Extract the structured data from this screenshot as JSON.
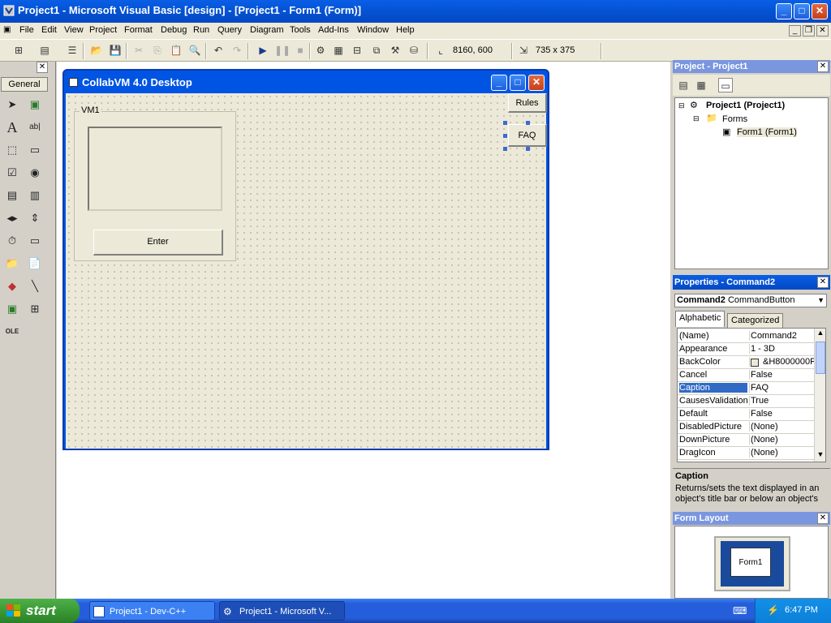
{
  "app": {
    "title": "Project1 - Microsoft Visual Basic [design] - [Project1 - Form1 (Form)]",
    "window_buttons": {
      "minimize": "_",
      "maximize": "□",
      "close": "✕"
    }
  },
  "menu": [
    "File",
    "Edit",
    "View",
    "Project",
    "Format",
    "Debug",
    "Run",
    "Query",
    "Diagram",
    "Tools",
    "Add-Ins",
    "Window",
    "Help"
  ],
  "toolbar": {
    "position": "8160, 600",
    "size": "735 x 375"
  },
  "toolbox": {
    "tab": "General",
    "close": "✕"
  },
  "form": {
    "title": "CollabVM 4.0 Desktop",
    "frame_label": "VM1",
    "enter": "Enter",
    "rules": "Rules",
    "faq": "FAQ"
  },
  "project_panel": {
    "title": "Project - Project1",
    "close": "✕",
    "root": "Project1 (Project1)",
    "folder": "Forms",
    "form_item": "Form1 (Form1)"
  },
  "properties_panel": {
    "title": "Properties - Command2",
    "close": "✕",
    "object_name": "Command2",
    "object_type": "CommandButton",
    "tabs": [
      "Alphabetic",
      "Categorized"
    ],
    "rows": [
      {
        "name": "(Name)",
        "value": "Command2"
      },
      {
        "name": "Appearance",
        "value": "1 - 3D"
      },
      {
        "name": "BackColor",
        "value": "&H8000000F"
      },
      {
        "name": "Cancel",
        "value": "False"
      },
      {
        "name": "Caption",
        "value": "FAQ"
      },
      {
        "name": "CausesValidation",
        "value": "True"
      },
      {
        "name": "Default",
        "value": "False"
      },
      {
        "name": "DisabledPicture",
        "value": "(None)"
      },
      {
        "name": "DownPicture",
        "value": "(None)"
      },
      {
        "name": "DragIcon",
        "value": "(None)"
      }
    ],
    "selected_row": "Caption",
    "desc_title": "Caption",
    "desc_text": "Returns/sets the text displayed in an object's title bar or below an object's"
  },
  "layout_panel": {
    "title": "Form Layout",
    "close": "✕",
    "form_label": "Form1"
  },
  "taskbar": {
    "start": "start",
    "tasks": [
      "Project1 - Dev-C++",
      "Project1 - Microsoft V..."
    ],
    "clock": "6:47 PM"
  },
  "colors": {
    "xp_blue": "#0054e3",
    "selection": "#316ac5",
    "start_green": "#3a9a35"
  }
}
